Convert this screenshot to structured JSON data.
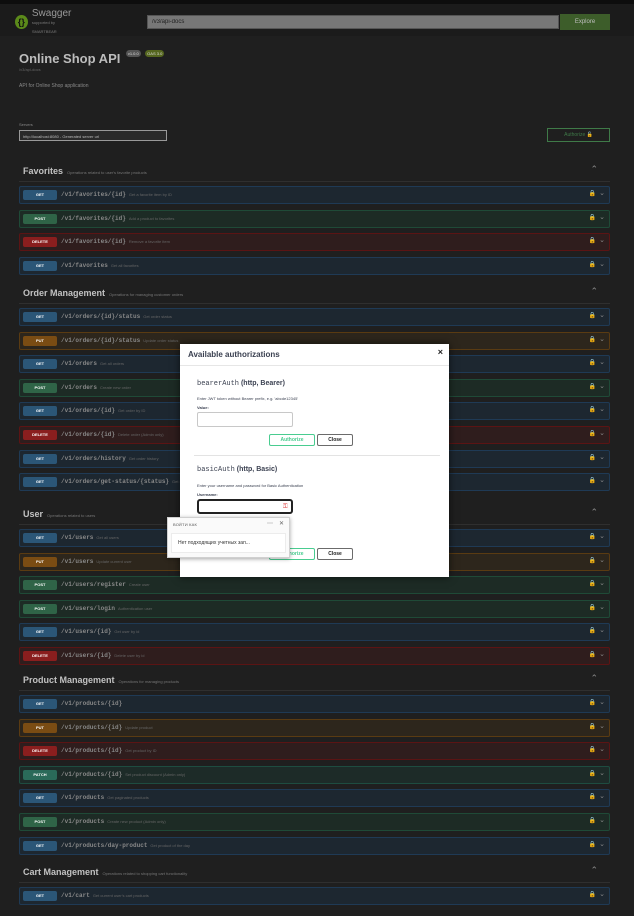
{
  "topbar": {
    "logo_text": "Swagger",
    "logo_sub": "supported by SMARTBEAR",
    "url_value": "/v3/api-docs",
    "explore_label": "Explore"
  },
  "info": {
    "title": "Online Shop API",
    "version": "v1.0.0",
    "oas": "OAS 3.0",
    "link": "/v3/api-docs",
    "description": "API for Online Shop application"
  },
  "servers": {
    "label": "Servers",
    "selected": "http://localhost:8080 - Generated server url"
  },
  "authorize_label": "Authorize",
  "sections": [
    {
      "name": "Favorites",
      "description": "Operations related to user's favorite products",
      "ops": [
        {
          "method": "GET",
          "cls": "get",
          "path": "/v1/favorites/{id}",
          "summary": "Get a favorite item by ID"
        },
        {
          "method": "POST",
          "cls": "post",
          "path": "/v1/favorites/{id}",
          "summary": "Add a product to favorites"
        },
        {
          "method": "DELETE",
          "cls": "delete",
          "path": "/v1/favorites/{id}",
          "summary": "Remove a favorite item"
        },
        {
          "method": "GET",
          "cls": "get",
          "path": "/v1/favorites",
          "summary": "Get all favorites"
        }
      ]
    },
    {
      "name": "Order Management",
      "description": "Operations for managing customer orders",
      "ops": [
        {
          "method": "GET",
          "cls": "get",
          "path": "/v1/orders/{id}/status",
          "summary": "Get order status"
        },
        {
          "method": "PUT",
          "cls": "put",
          "path": "/v1/orders/{id}/status",
          "summary": "Update order status"
        },
        {
          "method": "GET",
          "cls": "get",
          "path": "/v1/orders",
          "summary": "Get all orders"
        },
        {
          "method": "POST",
          "cls": "post",
          "path": "/v1/orders",
          "summary": "Create new order"
        },
        {
          "method": "GET",
          "cls": "get",
          "path": "/v1/orders/{id}",
          "summary": "Get order by ID"
        },
        {
          "method": "DELETE",
          "cls": "delete",
          "path": "/v1/orders/{id}",
          "summary": "Delete order (Admin only)"
        },
        {
          "method": "GET",
          "cls": "get",
          "path": "/v1/orders/history",
          "summary": "Get order history"
        },
        {
          "method": "GET",
          "cls": "get",
          "path": "/v1/orders/get-status/{status}",
          "summary": "Get orders by status"
        }
      ]
    },
    {
      "name": "User",
      "description": "Operations related to users",
      "ops": [
        {
          "method": "GET",
          "cls": "get",
          "path": "/v1/users",
          "summary": "Get all users"
        },
        {
          "method": "PUT",
          "cls": "put",
          "path": "/v1/users",
          "summary": "Update current user"
        },
        {
          "method": "POST",
          "cls": "post",
          "path": "/v1/users/register",
          "summary": "Create user"
        },
        {
          "method": "POST",
          "cls": "post",
          "path": "/v1/users/login",
          "summary": "Authentication user"
        },
        {
          "method": "GET",
          "cls": "get",
          "path": "/v1/users/{id}",
          "summary": "Get user by id"
        },
        {
          "method": "DELETE",
          "cls": "delete",
          "path": "/v1/users/{id}",
          "summary": "Delete user by id"
        }
      ]
    },
    {
      "name": "Product Management",
      "description": "Operations for managing products",
      "ops": [
        {
          "method": "GET",
          "cls": "get",
          "path": "/v1/products/{id}",
          "summary": ""
        },
        {
          "method": "PUT",
          "cls": "put",
          "path": "/v1/products/{id}",
          "summary": "Update product"
        },
        {
          "method": "DELETE",
          "cls": "delete",
          "path": "/v1/products/{id}",
          "summary": "Get product by ID"
        },
        {
          "method": "PATCH",
          "cls": "patch",
          "path": "/v1/products/{id}",
          "summary": "Set product discount (Admin only)"
        },
        {
          "method": "GET",
          "cls": "get",
          "path": "/v1/products",
          "summary": "Get paginated products"
        },
        {
          "method": "POST",
          "cls": "post",
          "path": "/v1/products",
          "summary": "Create new product (Admin only)"
        },
        {
          "method": "GET",
          "cls": "get",
          "path": "/v1/products/day-product",
          "summary": "Get product of the day"
        }
      ]
    },
    {
      "name": "Cart Management",
      "description": "Operations related to shopping cart functionality",
      "ops": [
        {
          "method": "GET",
          "cls": "get",
          "path": "/v1/cart",
          "summary": "Get current user's cart products"
        }
      ]
    }
  ],
  "modal": {
    "title": "Available authorizations",
    "close_icon": "×",
    "bearer": {
      "name": "bearerAuth",
      "type": "(http, Bearer)",
      "hint": "Enter JWT token without Bearer prefix, e.g. 'abcde12345'",
      "value_label": "Value:",
      "authorize_label": "Authorize",
      "close_label": "Close"
    },
    "basic": {
      "name": "basicAuth",
      "type": "(http, Basic)",
      "hint": "Enter your username and password for Basic Authentication",
      "username_label": "Username:",
      "authorize_label": "Authorize",
      "close_label": "Close"
    }
  },
  "autofill": {
    "title": "ВОЙТИ КАК",
    "more": "⋯",
    "close": "✕",
    "item": "Нет подходящих учетных зап..."
  }
}
